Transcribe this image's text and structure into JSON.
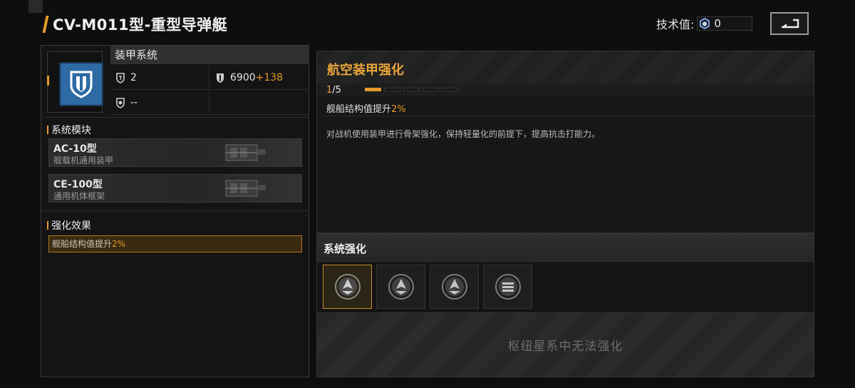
{
  "header": {
    "title": "CV-M011型-重型导弹艇",
    "tech_label": "技术值:",
    "tech_value": "0",
    "back_icon": "return-arrow-icon"
  },
  "left": {
    "armor_system": {
      "title": "装甲系统",
      "icon": "armor-shield-icon",
      "stat_a_value": "2",
      "stat_b_value": "6900",
      "stat_b_bonus": "+138",
      "stat_c_value": "--"
    },
    "modules_title": "系统模块",
    "modules": [
      {
        "name": "AC-10型",
        "desc": "舰载机通用装甲"
      },
      {
        "name": "CE-100型",
        "desc": "通用机体框架"
      }
    ],
    "effects_title": "强化效果",
    "effect": {
      "text": "舰船结构值提升",
      "pct": "2%"
    }
  },
  "right": {
    "title": "航空装甲强化",
    "level_current": "1",
    "level_max": "/5",
    "level_fill": 0.2,
    "effect_text": "舰船结构值提升",
    "effect_pct": "2%",
    "description": "对战机使用装甲进行骨架强化，保持轻量化的前提下，提高抗击打能力。",
    "system_title": "系统强化",
    "slots": [
      "armor-upgrade-icon",
      "armor-upgrade-icon",
      "armor-upgrade-icon",
      "structure-upgrade-icon"
    ],
    "lock_text": "枢纽星系中无法强化"
  },
  "colors": {
    "accent": "#e39a2a",
    "icon_blue": "#2e6aa3"
  }
}
